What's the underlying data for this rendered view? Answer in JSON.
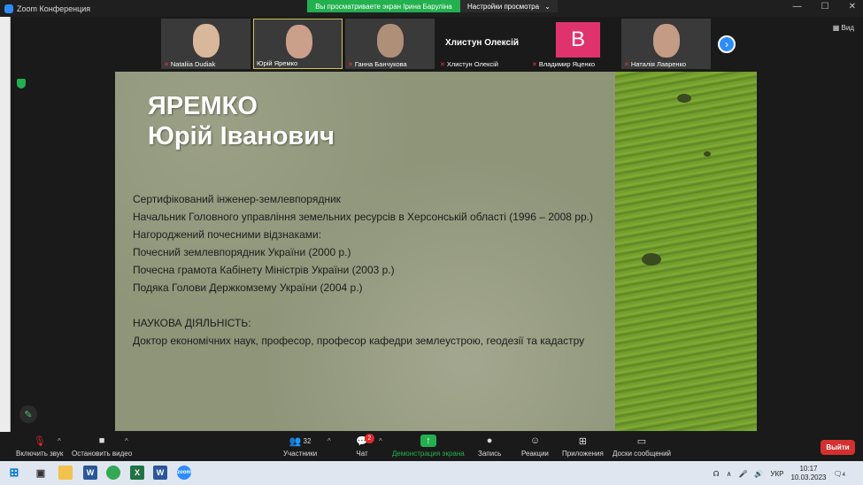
{
  "window": {
    "title": "Zoom Конференция"
  },
  "share_banner": {
    "text": "Вы просматриваете экран Ірина Баруліна",
    "settings_label": "Настройки просмотра"
  },
  "view_label": "Вид",
  "participants": [
    {
      "name": "Nataliia Dudiak",
      "muted": true,
      "face_color": "#d9b79a"
    },
    {
      "name": "Юрій Яремко",
      "muted": false,
      "face_color": "#caa08a"
    },
    {
      "name": "Ганна Банчукова",
      "muted": true,
      "face_color": "#b08f78"
    },
    {
      "name": "Хлистун Олексій",
      "muted": true,
      "big_label": "Хлистун Олексій"
    },
    {
      "name": "Владимир Яценко",
      "muted": true,
      "avatar_letter": "В"
    },
    {
      "name": "Наталія Лавренко",
      "muted": true,
      "face_color": "#c49b85"
    }
  ],
  "slide": {
    "title_line1": "ЯРЕМКО",
    "title_line2": "Юрій Іванович",
    "lines": [
      "Сертифікований інженер-землевпорядник",
      "Начальник Головного управління земельних ресурсів в Херсонській області (1996 – 2008 рр.)",
      "Нагороджений почесними відзнаками:",
      "Почесний землевпорядник України (2000 р.)",
      "Почесна грамота Кабінету Міністрів України (2003 р.)",
      "Подяка Голови Держкомзему України (2004 р.)"
    ],
    "section_heading": "НАУКОВА ДІЯЛЬНІСТЬ:",
    "section_text": "Доктор економічних наук, професор, професор кафедри землеустрою, геодезії та кадастру"
  },
  "toolbar": {
    "unmute": "Включить звук",
    "stop_video": "Остановить видео",
    "participants": "Участники",
    "participants_count": "32",
    "chat": "Чат",
    "chat_badge": "2",
    "share": "Демонстрация экрана",
    "record": "Запись",
    "reactions": "Реакции",
    "apps": "Приложения",
    "whiteboards": "Доски сообщений",
    "leave": "Выйти"
  },
  "taskbar": {
    "lang": "УКР",
    "time": "10:17",
    "date": "10.03.2023",
    "notifications": "4"
  }
}
